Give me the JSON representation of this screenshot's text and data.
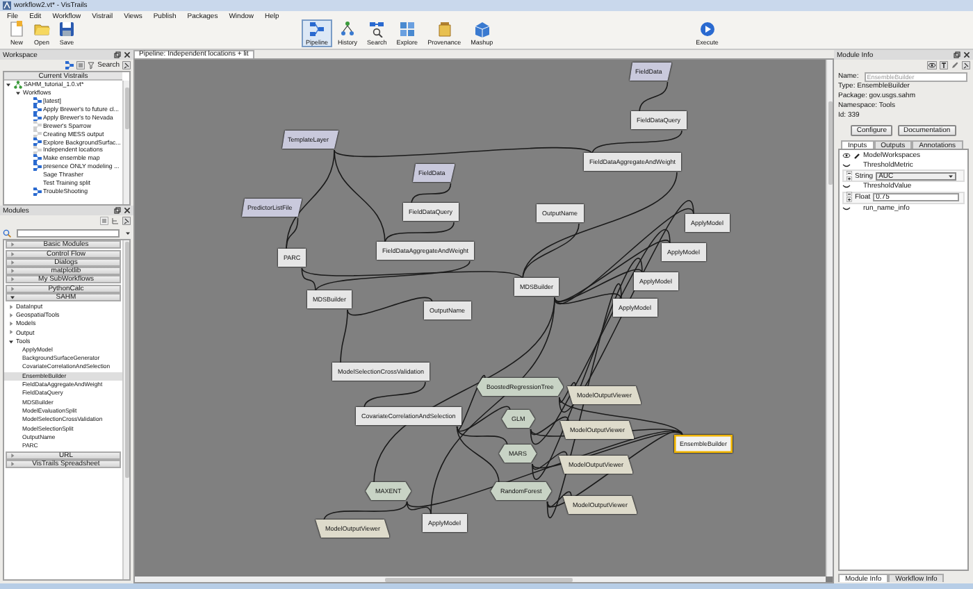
{
  "window": {
    "title": "workflow2.vt* - VisTrails"
  },
  "menu": [
    "File",
    "Edit",
    "Workflow",
    "Vistrail",
    "Views",
    "Publish",
    "Packages",
    "Window",
    "Help"
  ],
  "toolbar": {
    "file_buttons": [
      {
        "label": "New",
        "kind": "new"
      },
      {
        "label": "Open",
        "kind": "open"
      },
      {
        "label": "Save",
        "kind": "save"
      }
    ],
    "views": [
      {
        "label": "Pipeline",
        "kind": "pipeline",
        "selected": true
      },
      {
        "label": "History",
        "kind": "history",
        "selected": false
      },
      {
        "label": "Search",
        "kind": "search",
        "selected": false
      },
      {
        "label": "Explore",
        "kind": "explore",
        "selected": false
      },
      {
        "label": "Provenance",
        "kind": "provenance",
        "selected": false
      },
      {
        "label": "Mashup",
        "kind": "mashup",
        "selected": false
      }
    ],
    "execute": "Execute"
  },
  "workspace": {
    "title": "Workspace",
    "search_label": "Search",
    "tree_header": "Current Vistrails",
    "tree": [
      {
        "label": "SAHM_tutorial_1.0.vt*",
        "kind": "vistrail",
        "expanded": true,
        "children": [
          {
            "label": "Workflows",
            "expanded": true,
            "children": [
              {
                "label": "[latest]",
                "kind": "workflow"
              },
              {
                "label": "Apply Brewer's to future cl...",
                "kind": "workflow"
              },
              {
                "label": "Apply Brewer's to Nevada",
                "kind": "workflow"
              },
              {
                "label": "Brewer's Sparrow",
                "kind": "faint"
              },
              {
                "label": "Creating MESS output",
                "kind": "faint"
              },
              {
                "label": "Explore BackgroundSurfac...",
                "kind": "workflow"
              },
              {
                "label": "Independent locations",
                "kind": "faint"
              },
              {
                "label": "Make ensemble map",
                "kind": "workflow"
              },
              {
                "label": "presence ONLY modeling ...",
                "kind": "workflow"
              },
              {
                "label": "Sage Thrasher",
                "kind": "blank"
              },
              {
                "label": "Test Training split",
                "kind": "blank"
              },
              {
                "label": "TroubleShooting",
                "kind": "workflow"
              }
            ]
          }
        ]
      }
    ]
  },
  "modules": {
    "title": "Modules",
    "packages": [
      {
        "label": "Basic Modules",
        "expanded": false
      },
      {
        "label": "Control Flow",
        "expanded": false
      },
      {
        "label": "Dialogs",
        "expanded": false
      },
      {
        "label": "matplotlib",
        "expanded": false
      },
      {
        "label": "My SubWorkflows",
        "expanded": false
      },
      {
        "label": "PythonCalc",
        "expanded": false
      },
      {
        "label": "SAHM",
        "expanded": true,
        "children": [
          {
            "label": "DataInput",
            "expanded": false
          },
          {
            "label": "GeospatialTools",
            "expanded": false
          },
          {
            "label": "Models",
            "expanded": false
          },
          {
            "label": "Output",
            "expanded": false
          },
          {
            "label": "Tools",
            "expanded": true,
            "children": [
              {
                "label": "ApplyModel",
                "selected": false
              },
              {
                "label": "BackgroundSurfaceGenerator",
                "selected": false
              },
              {
                "label": "CovariateCorrelationAndSelection",
                "selected": false
              },
              {
                "label": "EnsembleBuilder",
                "selected": true
              },
              {
                "label": "FieldDataAggregateAndWeight",
                "selected": false
              },
              {
                "label": "FieldDataQuery",
                "selected": false
              },
              {
                "label": "MDSBuilder",
                "selected": false
              },
              {
                "label": "ModelEvaluationSplit",
                "selected": false
              },
              {
                "label": "ModelSelectionCrossValidation",
                "selected": false
              },
              {
                "label": "ModelSelectionSplit",
                "selected": false
              },
              {
                "label": "OutputName",
                "selected": false
              },
              {
                "label": "PARC",
                "selected": false
              }
            ]
          }
        ]
      },
      {
        "label": "URL",
        "expanded": false
      },
      {
        "label": "VisTrails Spreadsheet",
        "expanded": false
      }
    ]
  },
  "pipeline": {
    "tab": "Pipeline: Independent locations + lit",
    "nodes": [
      {
        "label": "FieldData",
        "kind": "parameter",
        "selected": false
      },
      {
        "label": "FieldDataQuery",
        "kind": "module",
        "selected": false
      },
      {
        "label": "FieldDataAggregateAndWeight",
        "kind": "module",
        "selected": false
      },
      {
        "label": "TemplateLayer",
        "kind": "parameter",
        "selected": false
      },
      {
        "label": "FieldData",
        "kind": "parameter",
        "selected": false
      },
      {
        "label": "FieldDataQuery",
        "kind": "module",
        "selected": false
      },
      {
        "label": "PredictorListFile",
        "kind": "parameter",
        "selected": false
      },
      {
        "label": "FieldDataAggregateAndWeight",
        "kind": "module",
        "selected": false
      },
      {
        "label": "PARC",
        "kind": "module",
        "selected": false
      },
      {
        "label": "MDSBuilder",
        "kind": "module",
        "selected": false
      },
      {
        "label": "OutputName",
        "kind": "module",
        "selected": false
      },
      {
        "label": "OutputName",
        "kind": "module",
        "selected": false
      },
      {
        "label": "MDSBuilder",
        "kind": "module",
        "selected": false
      },
      {
        "label": "ApplyModel",
        "kind": "module",
        "selected": false
      },
      {
        "label": "ApplyModel",
        "kind": "module",
        "selected": false
      },
      {
        "label": "ApplyModel",
        "kind": "module",
        "selected": false
      },
      {
        "label": "ApplyModel",
        "kind": "module",
        "selected": false
      },
      {
        "label": "ModelSelectionCrossValidation",
        "kind": "module",
        "selected": false
      },
      {
        "label": "CovariateCorrelationAndSelection",
        "kind": "module",
        "selected": false
      },
      {
        "label": "BoostedRegressionTree",
        "kind": "model",
        "selected": false
      },
      {
        "label": "ModelOutputViewer",
        "kind": "viewer",
        "selected": false
      },
      {
        "label": "GLM",
        "kind": "model",
        "selected": false
      },
      {
        "label": "ModelOutputViewer",
        "kind": "viewer",
        "selected": false
      },
      {
        "label": "MARS",
        "kind": "model",
        "selected": false
      },
      {
        "label": "ModelOutputViewer",
        "kind": "viewer",
        "selected": false
      },
      {
        "label": "EnsembleBuilder",
        "kind": "module",
        "selected": true
      },
      {
        "label": "MAXENT",
        "kind": "model",
        "selected": false
      },
      {
        "label": "RandomForest",
        "kind": "model",
        "selected": false
      },
      {
        "label": "ModelOutputViewer",
        "kind": "viewer",
        "selected": false
      },
      {
        "label": "ModelOutputViewer",
        "kind": "viewer",
        "selected": false
      },
      {
        "label": "ApplyModel",
        "kind": "module",
        "selected": false
      }
    ]
  },
  "module_info": {
    "title": "Module Info",
    "name_label": "Name:",
    "name_value": "EnsembleBuilder",
    "details": [
      "Type: EnsembleBuilder",
      "Package: gov.usgs.sahm",
      "Namespace: Tools",
      "Id: 339"
    ],
    "buttons": [
      "Configure",
      "Documentation"
    ],
    "tabs": [
      {
        "label": "Inputs",
        "selected": true
      },
      {
        "label": "Outputs",
        "selected": false
      },
      {
        "label": "Annotations",
        "selected": false
      }
    ],
    "ports": [
      {
        "label": "ModelWorkspaces",
        "kind": "connected"
      },
      {
        "label": "ThresholdMetric",
        "kind": "parameter",
        "field": {
          "type": "String",
          "value": "AUC",
          "kind": "select"
        }
      },
      {
        "label": "ThresholdValue",
        "kind": "parameter",
        "field": {
          "type": "Float",
          "value": "0.75",
          "kind": "text"
        }
      },
      {
        "label": "run_name_info",
        "kind": "parameter"
      }
    ],
    "bottom_tabs": [
      {
        "label": "Module Info",
        "selected": true
      },
      {
        "label": "Workflow Info",
        "selected": false
      }
    ]
  }
}
